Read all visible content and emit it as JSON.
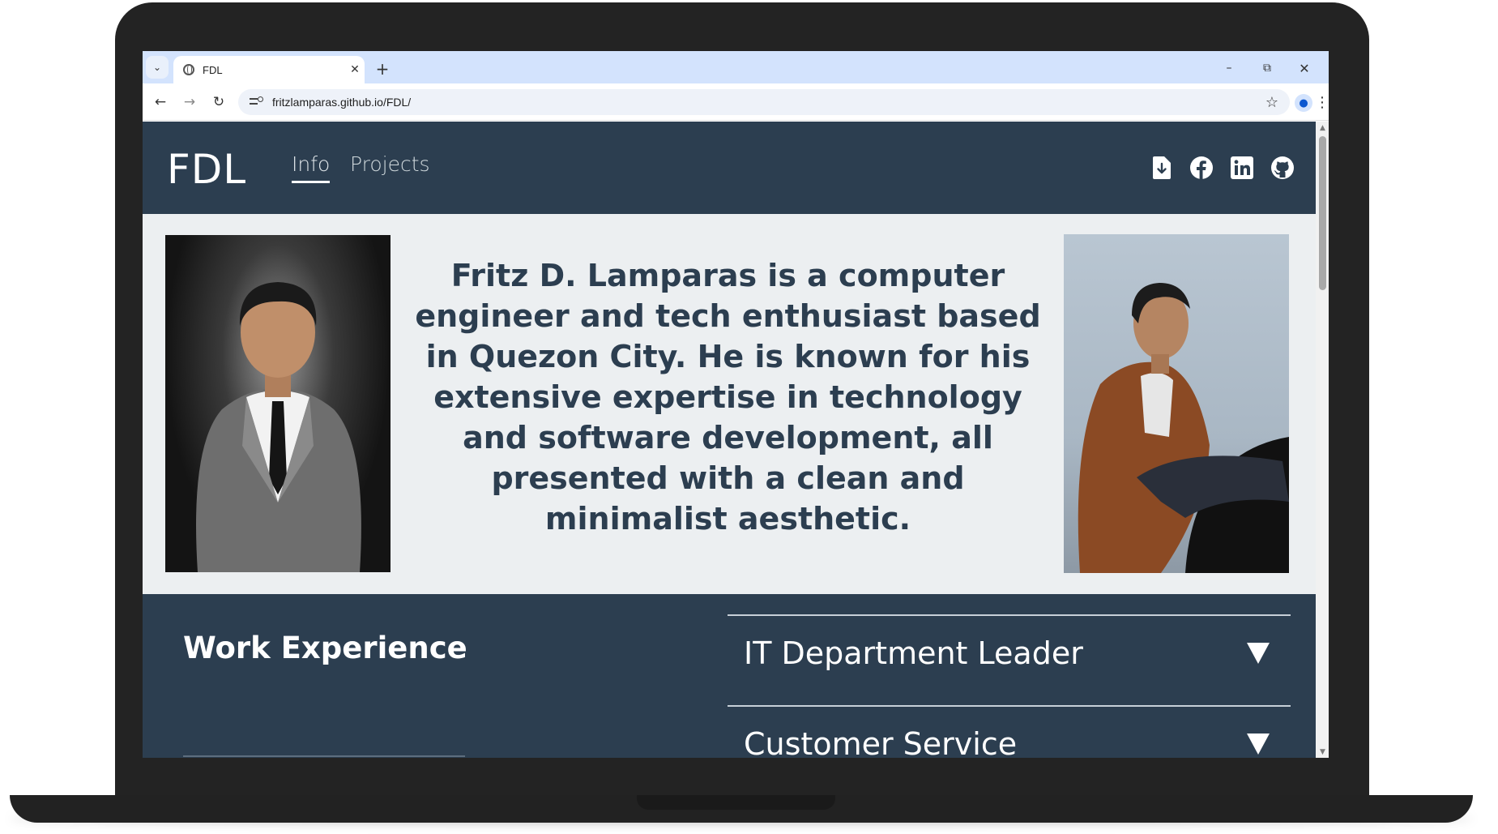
{
  "browser": {
    "tab_title": "FDL",
    "url": "fritzlamparas.github.io/FDL/",
    "tab_list_icon": "chevron-down-icon",
    "new_tab_label": "+",
    "window_controls": [
      "minimize-icon",
      "restore-icon",
      "close-icon"
    ]
  },
  "site": {
    "logo": "FDL",
    "nav": [
      {
        "label": "Info",
        "active": true
      },
      {
        "label": "Projects",
        "active": false
      }
    ],
    "social_icons": [
      "resume-download-icon",
      "facebook-icon",
      "linkedin-icon",
      "github-icon"
    ]
  },
  "hero": {
    "text": "Fritz D. Lamparas is a computer engineer and tech enthusiast based in Quezon City. He is known for his extensive expertise in technology and software development, all presented with a clean and minimalist aesthetic.",
    "left_photo": "formal-portrait-photo",
    "right_photo": "casual-portrait-photo"
  },
  "work": {
    "title": "Work Experience",
    "jobs": [
      {
        "title": "IT Department Leader",
        "toggle": "▼"
      },
      {
        "title": "Customer Service",
        "toggle": "▼"
      }
    ]
  },
  "colors": {
    "header_bg": "#2c3e50",
    "page_bg": "#eceff1",
    "accent_text": "#2c3e50",
    "tabbar_bg": "#d3e3fd"
  }
}
